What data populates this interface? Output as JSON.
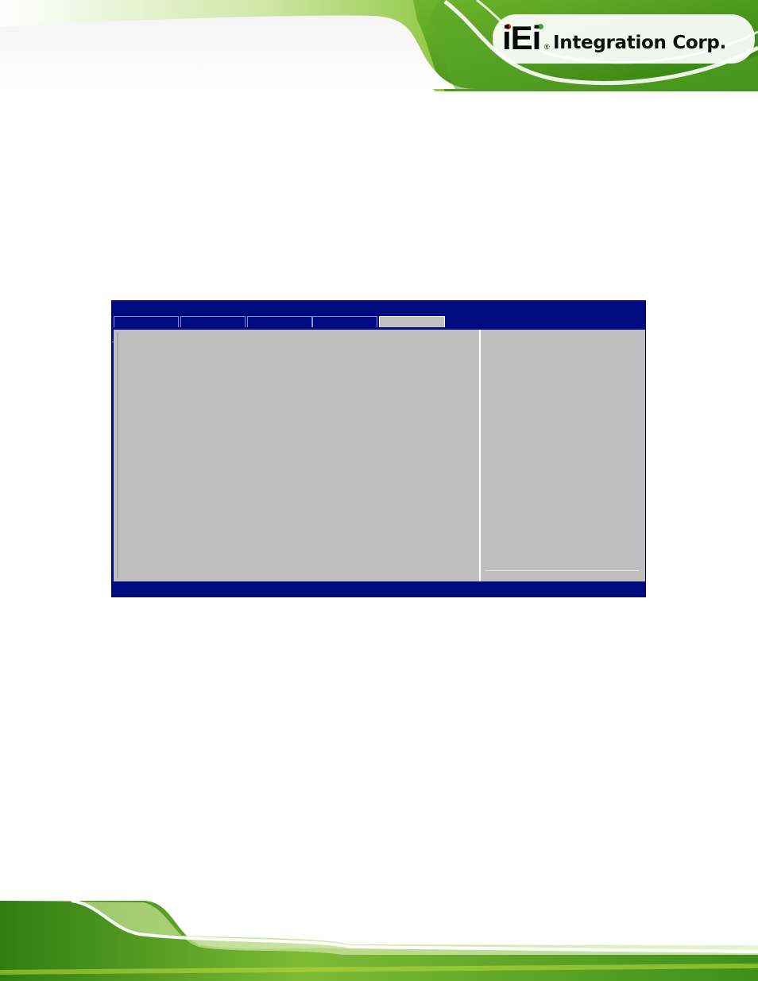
{
  "header": {
    "logo_mark": "iEi",
    "logo_registered": "®",
    "logo_text": "Integration Corp.",
    "colors": {
      "green_dark": "#2f7d12",
      "green_light": "#b8d83a",
      "logo_red": "#d2232a",
      "logo_green": "#3aa935"
    }
  },
  "bios_screen": {
    "title": "",
    "tabs": [
      {
        "label": "",
        "active": false
      },
      {
        "label": "",
        "active": false
      },
      {
        "label": "",
        "active": false
      },
      {
        "label": "",
        "active": false
      },
      {
        "label": "",
        "active": true
      }
    ],
    "status_text": "",
    "colors": {
      "frame": "#000b80",
      "panel": "#bfbfbf",
      "active_tab": "#c0c0c0"
    }
  }
}
